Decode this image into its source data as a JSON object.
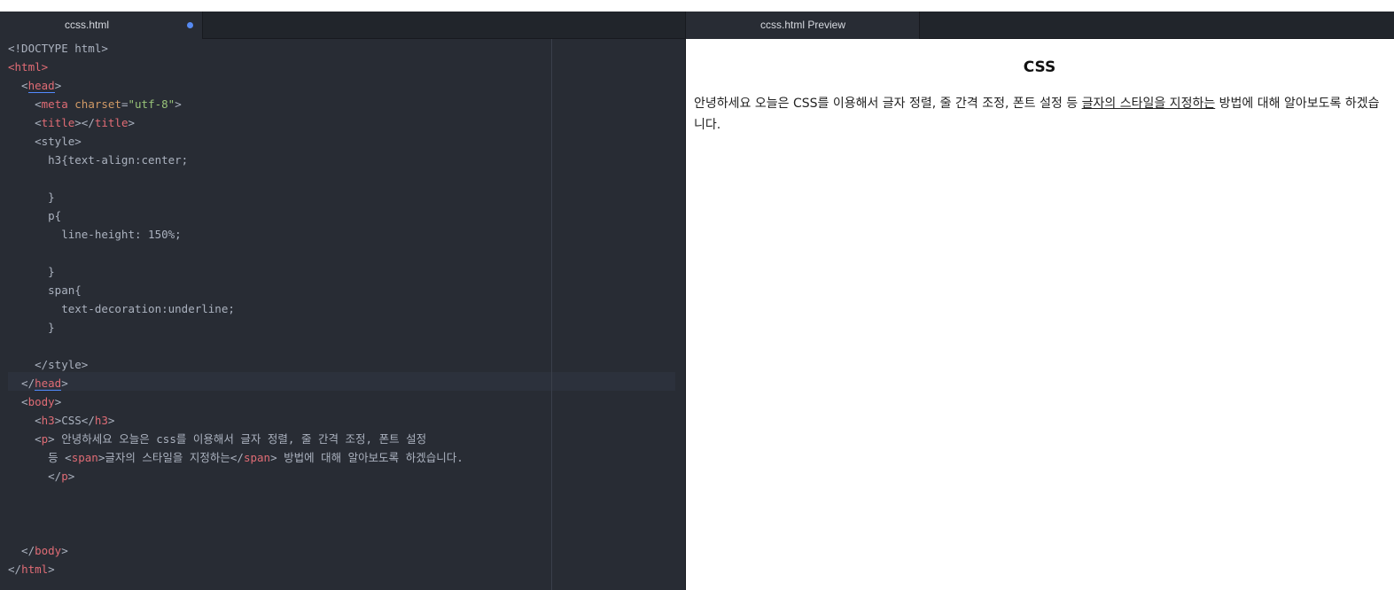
{
  "editor": {
    "tab_title": "ccss.html",
    "lines": [
      [
        {
          "t": "<!DOCTYPE html>"
        }
      ],
      [
        {
          "t": "<",
          "c": "tg"
        },
        {
          "t": "html",
          "c": "tg"
        },
        {
          "t": ">",
          "c": "tg"
        }
      ],
      [
        {
          "t": "  <"
        },
        {
          "t": "head",
          "c": "tg hl"
        },
        {
          "t": ">"
        }
      ],
      [
        {
          "t": "    <"
        },
        {
          "t": "meta",
          "c": "tg"
        },
        {
          "t": " "
        },
        {
          "t": "charset",
          "c": "at"
        },
        {
          "t": "="
        },
        {
          "t": "\"utf-8\"",
          "c": "st"
        },
        {
          "t": ">"
        }
      ],
      [
        {
          "t": "    <"
        },
        {
          "t": "title",
          "c": "tg"
        },
        {
          "t": "></"
        },
        {
          "t": "title",
          "c": "tg"
        },
        {
          "t": ">"
        }
      ],
      [
        {
          "t": "    <style>"
        }
      ],
      [
        {
          "t": "      h3{text-align:center;"
        }
      ],
      [
        {
          "t": ""
        }
      ],
      [
        {
          "t": "      }"
        }
      ],
      [
        {
          "t": "      p{"
        }
      ],
      [
        {
          "t": "        line-height: 150%;"
        }
      ],
      [
        {
          "t": ""
        }
      ],
      [
        {
          "t": "      }"
        }
      ],
      [
        {
          "t": "      span{"
        }
      ],
      [
        {
          "t": "        text-decoration:underline;"
        }
      ],
      [
        {
          "t": "      }"
        }
      ],
      [
        {
          "t": ""
        }
      ],
      [
        {
          "t": "    </style>"
        }
      ],
      [
        {
          "t": "  </"
        },
        {
          "t": "head",
          "c": "tg hl"
        },
        {
          "t": ">"
        }
      ],
      [
        {
          "t": "  <"
        },
        {
          "t": "body",
          "c": "tg"
        },
        {
          "t": ">"
        }
      ],
      [
        {
          "t": "    <"
        },
        {
          "t": "h3",
          "c": "tg"
        },
        {
          "t": ">CSS</"
        },
        {
          "t": "h3",
          "c": "tg"
        },
        {
          "t": ">"
        }
      ],
      [
        {
          "t": "    <"
        },
        {
          "t": "p",
          "c": "tg"
        },
        {
          "t": "> 안녕하세요 오늘은 css를 이용해서 글자 정렬, 줄 간격 조정, 폰트 설정"
        }
      ],
      [
        {
          "t": "      등 <"
        },
        {
          "t": "span",
          "c": "tg"
        },
        {
          "t": ">글자의 스타일을 지정하는</"
        },
        {
          "t": "span",
          "c": "tg"
        },
        {
          "t": "> 방법에 대해 알아보도록 하겠습니다."
        }
      ],
      [
        {
          "t": "      </"
        },
        {
          "t": "p",
          "c": "tg"
        },
        {
          "t": ">"
        }
      ],
      [
        {
          "t": ""
        }
      ],
      [
        {
          "t": ""
        }
      ],
      [
        {
          "t": ""
        }
      ],
      [
        {
          "t": "  </"
        },
        {
          "t": "body",
          "c": "tg"
        },
        {
          "t": ">"
        }
      ],
      [
        {
          "t": "</"
        },
        {
          "t": "html",
          "c": "tg"
        },
        {
          "t": ">"
        }
      ]
    ]
  },
  "preview": {
    "tab_title": "ccss.html Preview",
    "heading": "CSS",
    "para_before": "안녕하세요 오늘은 CSS를 이용해서 글자 정렬, 줄 간격 조정, 폰트 설정 등 ",
    "para_underlined": "글자의 스타일을 지정하는",
    "para_after": " 방법에 대해 알아보도록 하겠습니다."
  },
  "colors": {
    "editor_bg": "#282c34",
    "tag": "#e06c75",
    "attribute": "#d19a66",
    "string": "#98c379",
    "modified_indicator": "#568af2"
  }
}
